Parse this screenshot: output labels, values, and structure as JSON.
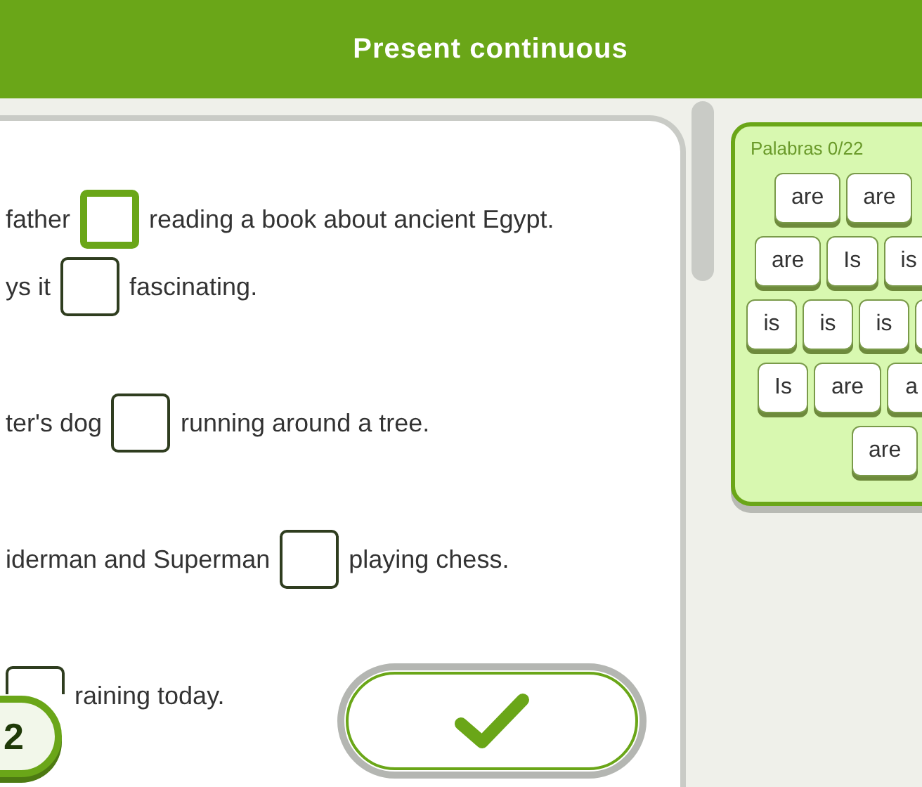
{
  "header": {
    "title": "Present continuous"
  },
  "paragraphs": [
    {
      "lines": [
        {
          "before": "father",
          "blank": {
            "selected": true
          },
          "after": "reading a book about ancient Egypt."
        },
        {
          "before": "ys it",
          "blank": {
            "selected": false
          },
          "after": "fascinating."
        }
      ]
    },
    {
      "lines": [
        {
          "before": "ter's dog",
          "blank": {
            "selected": false
          },
          "after": "running around a tree."
        }
      ]
    },
    {
      "lines": [
        {
          "before": "iderman and Superman",
          "blank": {
            "selected": false
          },
          "after": "playing chess."
        }
      ]
    },
    {
      "lines": [
        {
          "blank": {
            "selected": false,
            "covered": true
          },
          "after": "raining today."
        }
      ]
    }
  ],
  "badge": "2",
  "word_bank": {
    "title": "Palabras 0/22",
    "rows": [
      [
        {
          "label": "are"
        },
        {
          "label": "are"
        }
      ],
      [
        {
          "label": "are"
        },
        {
          "label": "Is"
        },
        {
          "label": "is"
        }
      ],
      [
        {
          "label": "is"
        },
        {
          "label": "is"
        },
        {
          "label": "is"
        },
        {}
      ],
      [
        {
          "label": "Is"
        },
        {
          "label": "are"
        },
        {
          "label": "a"
        }
      ],
      [
        {
          "label": "are"
        }
      ]
    ]
  }
}
